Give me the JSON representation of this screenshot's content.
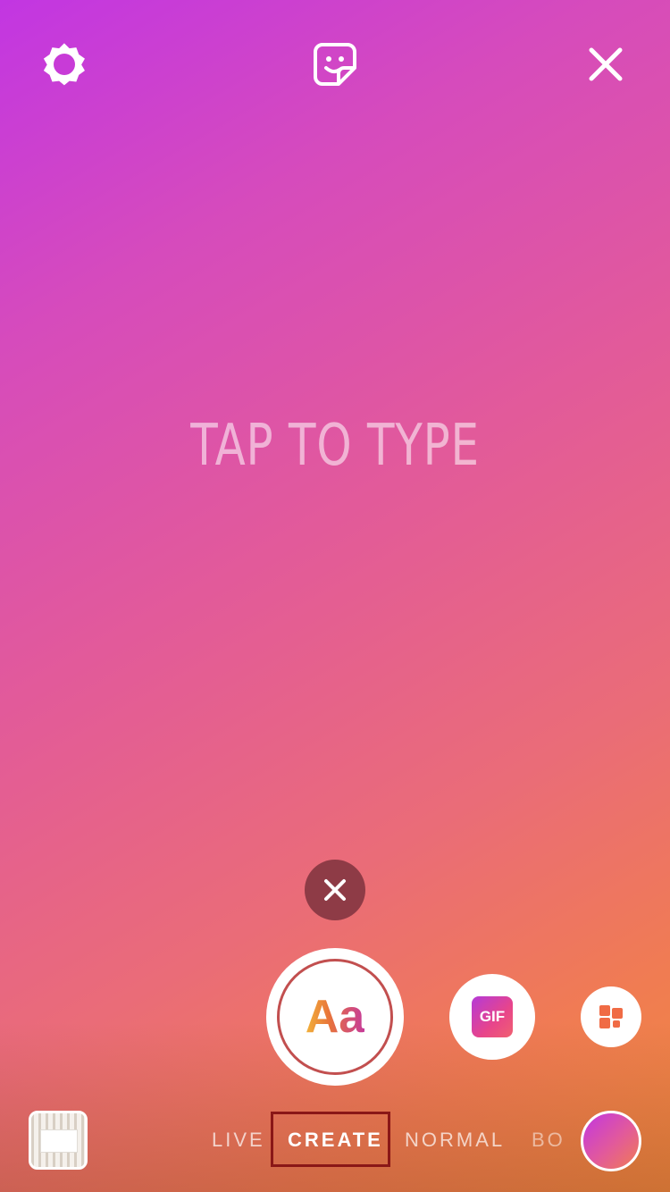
{
  "canvas": {
    "placeholder": "TAP TO TYPE",
    "background_colors": [
      "#c236e2",
      "#e25a9a",
      "#ef8a3c"
    ]
  },
  "top_bar": {
    "left_icon": "settings-icon",
    "center_icon": "sticker-icon",
    "right_icon": "close-icon"
  },
  "tools": {
    "dismiss_icon": "close-icon",
    "text_tool_label": "Aa",
    "gif_tool_label": "GIF",
    "layout_icon": "layout-icon"
  },
  "bottom_bar": {
    "gallery_icon": "gallery-thumbnail",
    "modes": [
      {
        "label": "LIVE",
        "selected": false
      },
      {
        "label": "CREATE",
        "selected": true
      },
      {
        "label": "NORMAL",
        "selected": false
      },
      {
        "label": "BO",
        "selected": false
      }
    ],
    "capture_icon": "capture-button",
    "highlight_color": "#8a1717"
  }
}
